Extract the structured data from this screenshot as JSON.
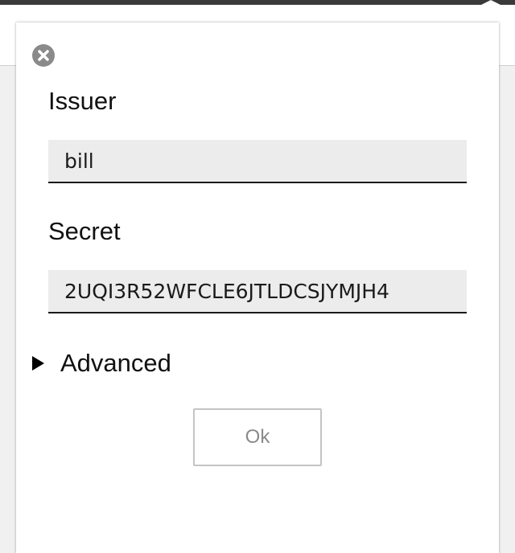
{
  "dialog": {
    "issuer_label": "Issuer",
    "issuer_value": "bill",
    "secret_label": "Secret",
    "secret_value": "2UQI3R52WFCLE6JTLDCSJYMJH4",
    "advanced_label": "Advanced",
    "ok_label": "Ok",
    "close_icon": "close-icon"
  },
  "colors": {
    "top_bar": "#3a3a3a",
    "input_background": "#ececec",
    "input_underline": "#1a1a1a",
    "close_icon_bg": "#8a8a8a",
    "ok_text": "#8a8a8a"
  }
}
